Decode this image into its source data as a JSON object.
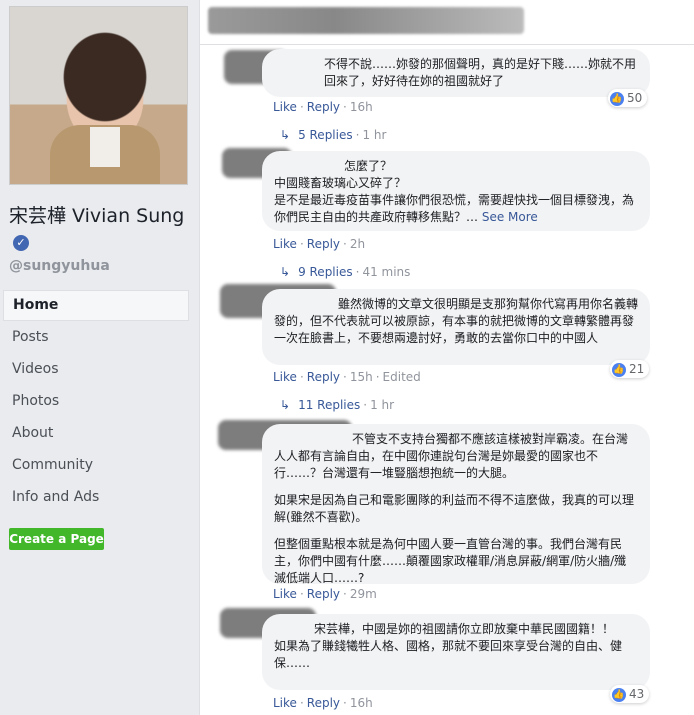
{
  "profile": {
    "name": "宋芸樺 Vivian Sung",
    "handle": "@sungyuhua"
  },
  "nav": [
    "Home",
    "Posts",
    "Videos",
    "Photos",
    "About",
    "Community",
    "Info and Ads"
  ],
  "create_page_label": "Create a Page",
  "comments": [
    {
      "lines": [
        "不得不說……妳發的那個聲明，真的是好下賤……妳就不用回來了，好好待在妳的祖國就好了"
      ],
      "like": "Like",
      "reply": "Reply",
      "time": "16h",
      "edited": "",
      "reactions": "50",
      "replies": "5 Replies",
      "replies_time": "1 hr"
    },
    {
      "lines": [
        "怎麼了？",
        "中國賤畜玻璃心又碎了？",
        "是不是最近毒疫苗事件讓你們很恐慌，需要趕快找一個目標發洩，為你們民主自由的共產政府轉移焦點？…"
      ],
      "see_more": "See More",
      "like": "Like",
      "reply": "Reply",
      "time": "2h",
      "edited": "",
      "reactions": "",
      "replies": "9 Replies",
      "replies_time": "41 mins"
    },
    {
      "lines": [
        "雖然微博的文章文很明顯是支那狗幫你代寫再用你名義轉發的，但不代表就可以被原諒，有本事的就把微博的文章轉繁體再發一次在臉書上，不要想兩邊討好，勇敢的去當你口中的中國人"
      ],
      "like": "Like",
      "reply": "Reply",
      "time": "15h",
      "edited": "Edited",
      "reactions": "21",
      "replies": "11 Replies",
      "replies_time": "1 hr"
    },
    {
      "paragraphs": [
        "不管支不支持台獨都不應該這樣被對岸霸凌。在台灣人人都有言論自由，在中國你連說句台灣是妳最愛的國家也不行……？台灣還有一堆豎腦想抱統一的大腿。",
        "如果宋是因為自己和電影團隊的利益而不得不這麼做，我真的可以理解(雖然不喜歡)。",
        "但整個重點根本就是為何中國人要一直管台灣的事。我們台灣有民主，你們中國有什麼……顛覆國家政權罪/消息屏蔽/網軍/防火牆/殲滅低端人口……?"
      ],
      "like": "Like",
      "reply": "Reply",
      "time": "29m",
      "edited": "",
      "reactions": ""
    },
    {
      "lines": [
        "宋芸樺，中國是妳的祖國請你立即放棄中華民國國籍！！",
        "如果為了賺錢犧牲人格、國格，那就不要回來享受台灣的自由、健保……"
      ],
      "like": "Like",
      "reply": "Reply",
      "time": "16h",
      "edited": "",
      "reactions": "43"
    }
  ]
}
